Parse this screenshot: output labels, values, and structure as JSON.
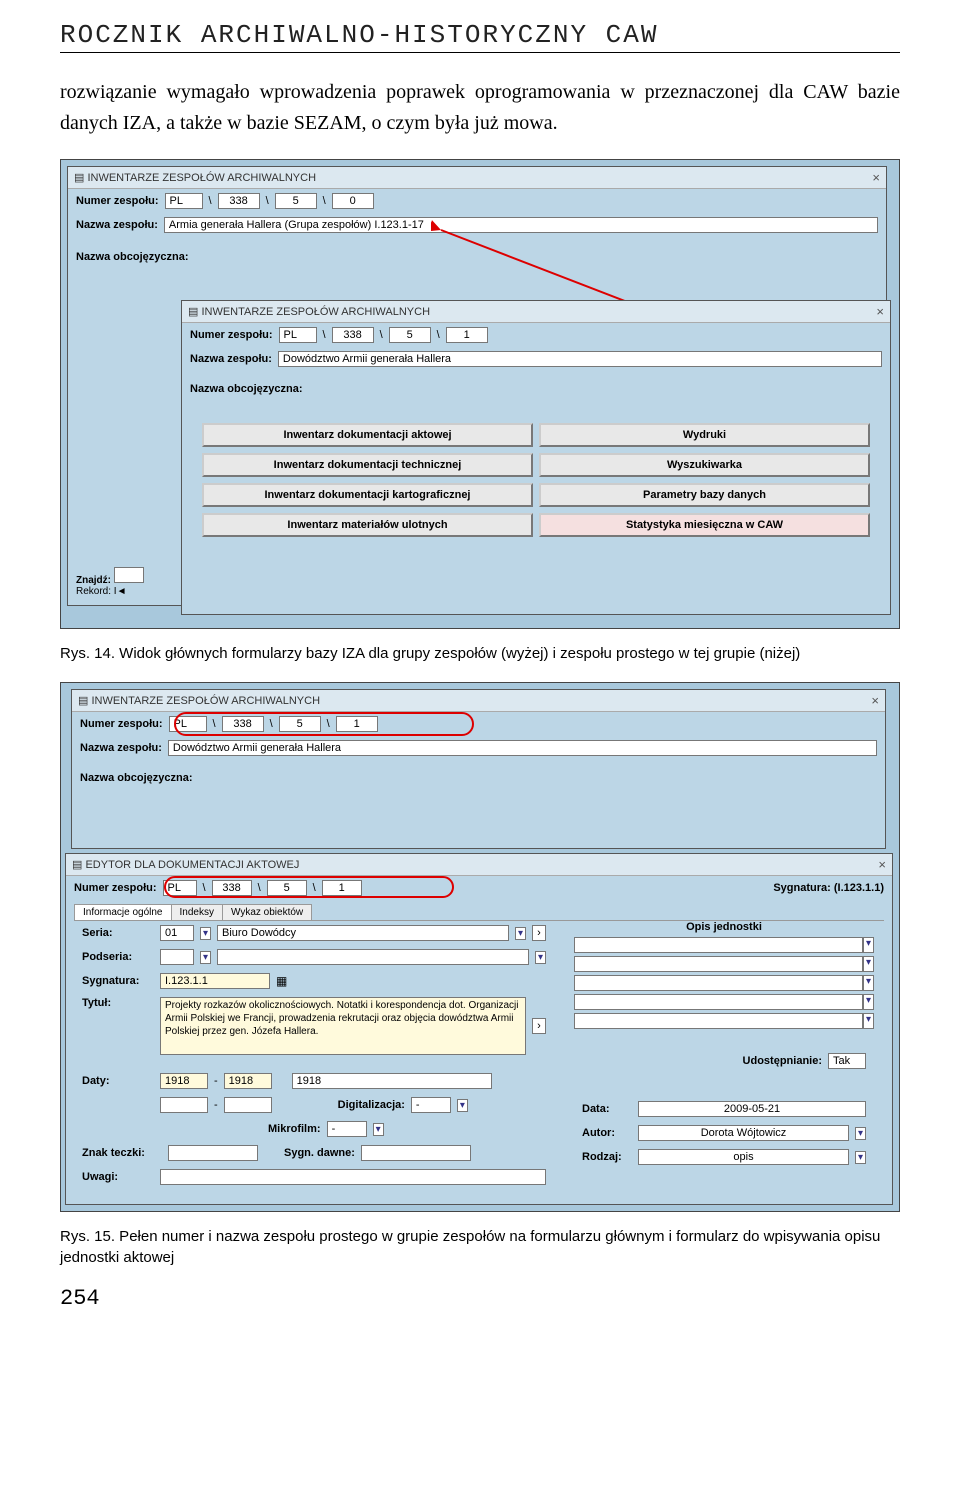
{
  "header": {
    "title": "ROCZNIK ARCHIWALNO-HISTORYCZNY CAW"
  },
  "para1": "rozwiązanie wymagało wprowadzenia poprawek oprogramowania w przeznaczonej dla CAW bazie danych IZA, a także w bazie SEZAM, o czym była już mowa.",
  "caption14": "Rys. 14. Widok głównych formularzy bazy IZA dla grupy zespołów (wyżej) i zespołu prostego w tej grupie (niżej)",
  "caption15": "Rys. 15. Pełen numer i nazwa zespołu prostego w grupie zespołów na formularzu głównym i formularz do wpisywania opisu jednostki aktowej",
  "pageNum": "254",
  "fig1": {
    "winTitle": "INWENTARZE ZESPOŁÓW ARCHIWALNYCH",
    "numLabel": "Numer zespołu:",
    "nameLabel": "Nazwa zespołu:",
    "foreignLabel": "Nazwa obcojęzyczna:",
    "a": {
      "p1": "PL",
      "p2": "338",
      "p3": "5",
      "p4": "0",
      "name": "Armia generała Hallera (Grupa zespołów) I.123.1-17"
    },
    "b": {
      "p1": "PL",
      "p2": "338",
      "p3": "5",
      "p4": "1",
      "name": "Dowództwo Armii generała Hallera"
    },
    "buttons": {
      "b1": "Inwentarz dokumentacji aktowej",
      "b2": "Wydruki",
      "b3": "Inwentarz dokumentacji technicznej",
      "b4": "Wyszukiwarka",
      "b5": "Inwentarz dokumentacji kartograficznej",
      "b6": "Parametry bazy danych",
      "b7": "Inwentarz materiałów ulotnych",
      "b8": "Statystyka miesięczna w CAW"
    },
    "find": "Znajdź:",
    "rec": "Rekord: I◄"
  },
  "fig2": {
    "winTitle1": "INWENTARZE ZESPOŁÓW ARCHIWALNYCH",
    "numLabel": "Numer zespołu:",
    "nameLabel": "Nazwa zespołu:",
    "foreignLabel": "Nazwa obcojęzyczna:",
    "top": {
      "p1": "PL",
      "p2": "338",
      "p3": "5",
      "p4": "1",
      "name": "Dowództwo Armii generała Hallera"
    },
    "winTitle2": "EDYTOR DLA DOKUMENTACJI AKTOWEJ",
    "sygLabel": "Sygnatura: (I.123.1.1)",
    "tabs": {
      "t1": "Informacje ogólne",
      "t2": "Indeksy",
      "t3": "Wykaz obiektów"
    },
    "seriaL": "Seria:",
    "seriaV": "01",
    "seriaT": "Biuro Dowódcy",
    "podL": "Podseria:",
    "sygL": "Sygnatura:",
    "sygV": "I.123.1.1",
    "tytL": "Tytuł:",
    "tytV": "Projekty rozkazów okolicznościowych. Notatki i korespondencja dot. Organizacji Armii Polskiej we Francji, prowadzenia rekrutacji oraz objęcia dowództwa Armii Polskiej przez gen. Józefa Hallera.",
    "datyL": "Daty:",
    "d1": "1918",
    "d2": "1918",
    "d3": "1918",
    "digL": "Digitalizacja:",
    "digV": "-",
    "mikL": "Mikrofilm:",
    "mikV": "-",
    "znakL": "Znak teczki:",
    "sdL": "Sygn. dawne:",
    "uwL": "Uwagi:",
    "opisL": "Opis jednostki",
    "udL": "Udostępnianie:",
    "udV": "Tak",
    "dataL": "Data:",
    "dataV": "2009-05-21",
    "autL": "Autor:",
    "autV": "Dorota Wójtowicz",
    "rodzL": "Rodzaj:",
    "rodzV": "opis"
  }
}
